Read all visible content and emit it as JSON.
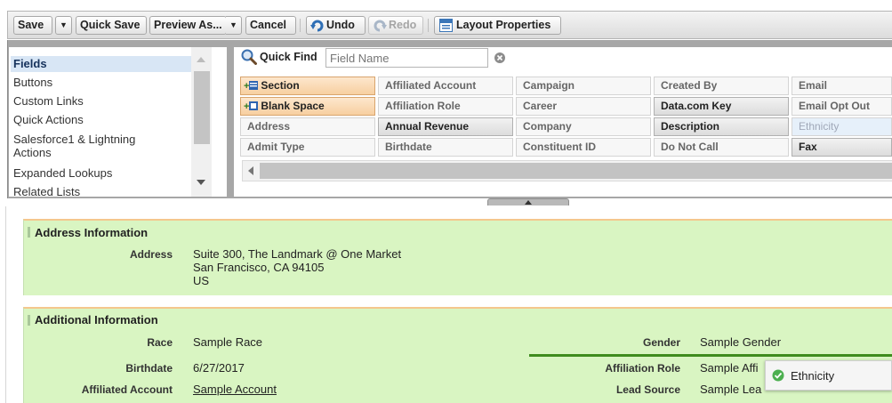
{
  "toolbar": {
    "save": "Save",
    "save_menu": "▼",
    "quick_save": "Quick Save",
    "preview_as": "Preview As...",
    "preview_menu": "▼",
    "cancel": "Cancel",
    "undo": "Undo",
    "redo": "Redo",
    "layout_properties": "Layout Properties"
  },
  "categories": {
    "fields": "Fields",
    "buttons": "Buttons",
    "custom_links": "Custom Links",
    "quick_actions": "Quick Actions",
    "sf1_line1": "Salesforce1 & Lightning",
    "sf1_line2": "Actions",
    "expanded_lookups": "Expanded Lookups",
    "related_lists": "Related Lists"
  },
  "quick_find": {
    "label": "Quick Find",
    "placeholder": "Field Name"
  },
  "fields": {
    "section": "Section",
    "blank_space": "Blank Space",
    "address": "Address",
    "admit_type": "Admit Type",
    "affiliated_account": "Affiliated Account",
    "affiliation_role": "Affiliation Role",
    "annual_revenue": "Annual Revenue",
    "birthdate": "Birthdate",
    "campaign": "Campaign",
    "career": "Career",
    "company": "Company",
    "constituent_id": "Constituent ID",
    "created_by": "Created By",
    "datacom_key": "Data.com Key",
    "description": "Description",
    "do_not_call": "Do Not Call",
    "email": "Email",
    "email_opt_out": "Email Opt Out",
    "ethnicity": "Ethnicity",
    "fax": "Fax"
  },
  "address_section": {
    "title": "Address Information",
    "address_label": "Address",
    "address_line1": "Suite 300, The Landmark @ One Market",
    "address_line2": "San Francisco, CA 94105",
    "address_line3": "US"
  },
  "additional_section": {
    "title": "Additional Information",
    "race_label": "Race",
    "race_value": "Sample Race",
    "gender_label": "Gender",
    "gender_value": "Sample Gender",
    "birthdate_label": "Birthdate",
    "birthdate_value": "6/27/2017",
    "affiliation_role_label": "Affiliation Role",
    "affiliation_role_value": "Sample Affi",
    "affiliated_account_label": "Affiliated Account",
    "affiliated_account_value": "Sample Account",
    "lead_source_label": "Lead Source",
    "lead_source_value": "Sample Lea"
  },
  "drag_tooltip": {
    "text": "Ethnicity"
  },
  "colors": {
    "section_bg": "#d9f5c2",
    "drop_line": "#3f8c1e",
    "check": "#4caf50"
  }
}
